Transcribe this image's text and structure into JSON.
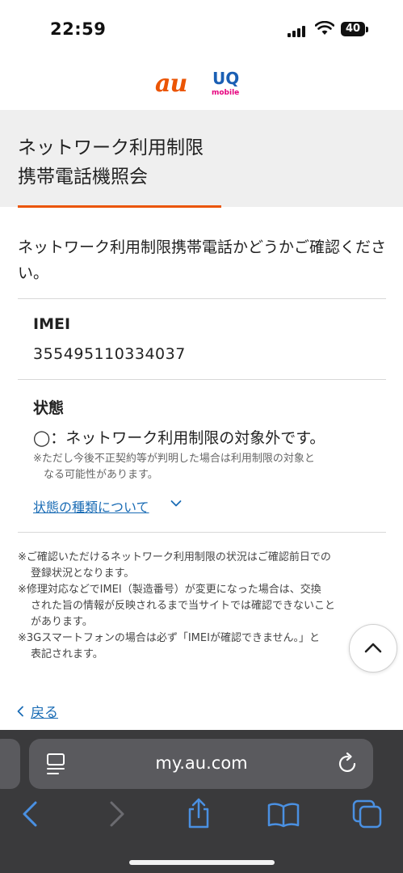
{
  "status_bar": {
    "time": "22:59",
    "battery": "40"
  },
  "brand": {
    "au": "au",
    "uq": "UQ",
    "uq_sub": "mobile"
  },
  "title": {
    "line1": "ネットワーク利用制限",
    "line2": "携帯電話機照会"
  },
  "intro": "ネットワーク利用制限携帯電話かどうかご確認ください。",
  "imei": {
    "label": "IMEI",
    "value": "355495110334037"
  },
  "status": {
    "label": "状態",
    "result": "◯：ネットワーク利用制限の対象外です。",
    "note_line1": "※ただし今後不正契約等が判明した場合は利用制限の対象と",
    "note_line2": "なる可能性があります。",
    "link": "状態の種類について"
  },
  "footnotes": {
    "n1a": "※ご確認いただけるネットワーク利用制限の状況はご確認前日での",
    "n1b": "登録状況となります。",
    "n2a": "※修理対応などでIMEI（製造番号）が変更になった場合は、交換",
    "n2b": "された旨の情報が反映されるまで当サイトでは確認できないこと",
    "n2c": "があります。",
    "n3a": "※3Gスマートフォンの場合は必ず「IMEIが確認できません。」と",
    "n3b": "表記されます。"
  },
  "back": {
    "label": "戻る"
  },
  "browser": {
    "url": "my.au.com"
  },
  "colors": {
    "accent": "#eb5505",
    "link": "#1a6cb5",
    "toolbar_icon": "#4a90e2"
  },
  "icons": {
    "signal": "signal-icon",
    "wifi": "wifi-icon",
    "battery": "battery-icon",
    "chevron_down": "chevron-down-icon",
    "chevron_up": "chevron-up-icon",
    "back": "chevron-left-icon",
    "page_menu": "page-menu-icon",
    "reload": "reload-icon",
    "nav_back": "back-arrow-icon",
    "nav_forward": "forward-arrow-icon",
    "share": "share-icon",
    "bookmarks": "bookmarks-icon",
    "tabs": "tabs-icon"
  }
}
